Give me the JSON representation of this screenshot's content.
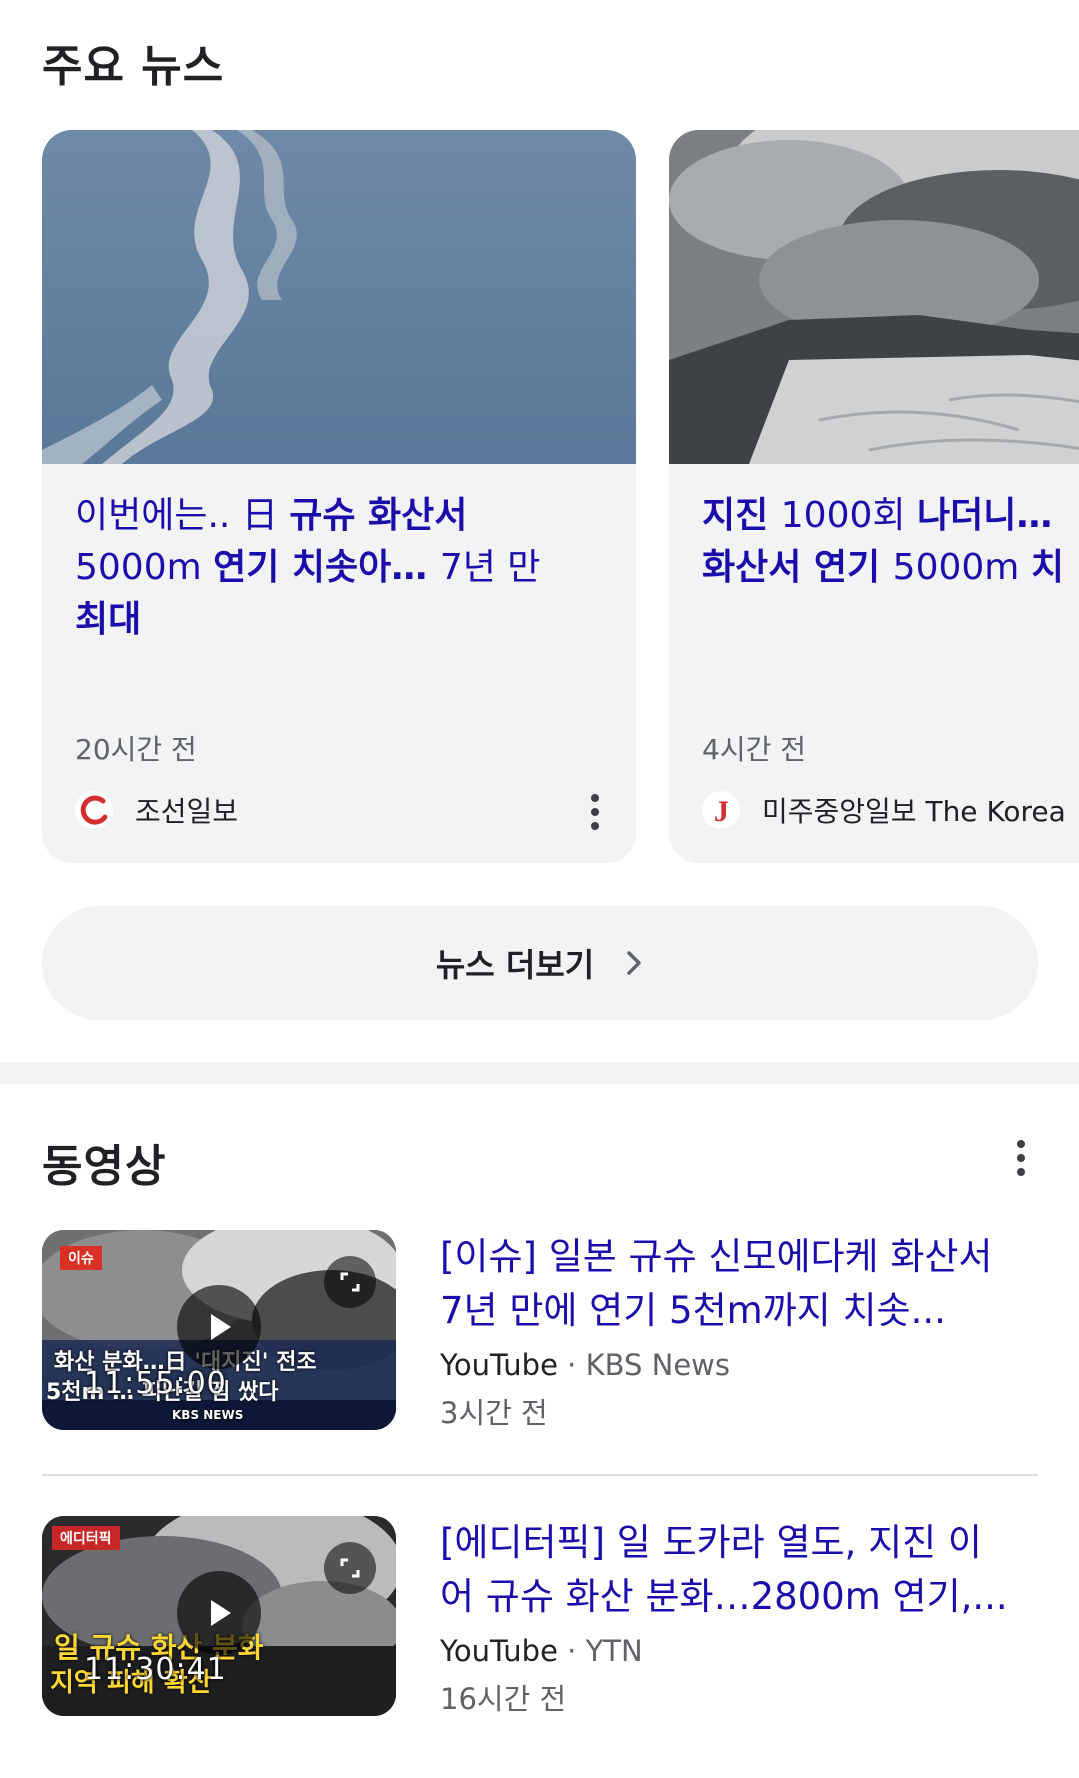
{
  "top_news": {
    "title": "주요 뉴스",
    "cards": [
      {
        "headline_a": "이번에는.. ",
        "headline_b": "日 ",
        "headline_c": "규슈 화산서",
        "headline_line2a": "5000m ",
        "headline_line2b": "연기 치솟아… ",
        "headline_line2c": "7년 만",
        "headline_line3": "최대",
        "time": "20시간 전",
        "source": "조선일보",
        "logo_icon": "chosun-logo-icon"
      },
      {
        "headline_line1a": "지진 ",
        "headline_line1b": "1000회 ",
        "headline_line1c": "나더니…",
        "headline_line2a": "화산서 연기 ",
        "headline_line2b": "5000m ",
        "headline_line2c": "치",
        "time": "4시간 전",
        "source": "미주중앙일보 The Korea",
        "logo_icon": "joongang-logo-icon"
      }
    ],
    "more_label": "뉴스 더보기"
  },
  "videos": {
    "title": "동영상",
    "items": [
      {
        "title_line1": "[이슈] 일본 규슈 신모에다케 화산서",
        "title_line2": "7년 만에 연기 5천m까지 치솟...",
        "platform": "YouTube",
        "separator": " · ",
        "channel": "KBS News",
        "time": "3시간 전",
        "duration": "11:55:00",
        "thumb_tag": "이슈",
        "thumb_caption": "화산 분화…日 '대지진' 전조",
        "thumb_caption2": "5천m … 피난길 짐 쌌다",
        "thumb_brand": "KBS NEWS"
      },
      {
        "title_line1": "[에디터픽] 일 도카라 열도, 지진 이",
        "title_line2": "어 규슈 화산 분화…2800m 연기,...",
        "platform": "YouTube",
        "separator": " · ",
        "channel": "YTN",
        "time": "16시간 전",
        "duration": "11:30:41",
        "thumb_tag": "에디터픽",
        "thumb_caption": "일 규슈 화산 분화",
        "thumb_caption2": "지역 피해 확산"
      }
    ]
  },
  "colors": {
    "link_blue": "#1a0dab",
    "card_bg": "#f1f3f4",
    "muted_text": "#5f6368"
  }
}
